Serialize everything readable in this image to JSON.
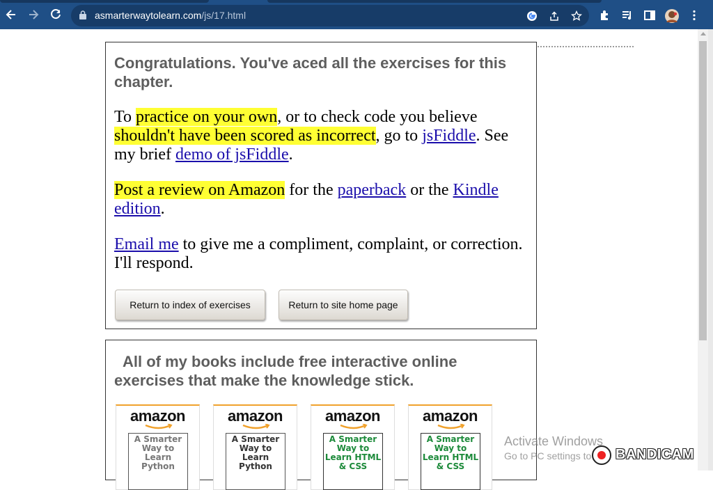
{
  "browser": {
    "url_domain": "asmarterwaytolearn.com",
    "url_path": "/js/17.html",
    "icons": [
      "back-icon",
      "forward-icon",
      "reload-icon",
      "lock-icon",
      "google-icon",
      "share-icon",
      "star-icon",
      "extensions-icon",
      "media-icon",
      "sidepanel-icon",
      "profile-avatar",
      "menu-icon"
    ]
  },
  "card": {
    "heading": "Congratulations. You've aced all the exercises for this chapter.",
    "para1": {
      "t1": "To ",
      "hl1": "practice on your own",
      "t2": ", or to check code you believe ",
      "hl2": "shouldn't have been scored as incorrect",
      "t3": ", go to ",
      "link1": "jsFiddle",
      "t4": ". See my brief ",
      "link2": "demo of jsFiddle",
      "t5": "."
    },
    "para2": {
      "hl": "Post a review on Amazon",
      "t1": " for the ",
      "link1": "paperback",
      "t2": " or the ",
      "link2": "Kindle edition",
      "t3": "."
    },
    "para3": {
      "link": "Email me",
      "t1": " to give me a compliment, complaint, or correction. I'll respond."
    },
    "buttons": {
      "index": "Return to index of exercises",
      "home": "Return to site home page"
    }
  },
  "books": {
    "heading": "All of my books include free interactive online exercises that make the knowledge stick.",
    "brand": "amazon",
    "items": [
      {
        "title": "A Smarter Way to Learn Python"
      },
      {
        "title": "A Smarter Way to Learn Python"
      },
      {
        "title": "A Smarter Way to Learn HTML & CSS"
      },
      {
        "title": "A Smarter Way to Learn HTML & CSS"
      }
    ]
  },
  "overlay": {
    "activate_title": "Activate Windows",
    "activate_sub": "Go to PC settings to",
    "recorder": "BANDICAM"
  },
  "colors": {
    "chrome_bg": "#1f4f86",
    "highlight": "#ffff33",
    "link": "#1a0dab",
    "amazon_orange": "#f0a12b"
  }
}
